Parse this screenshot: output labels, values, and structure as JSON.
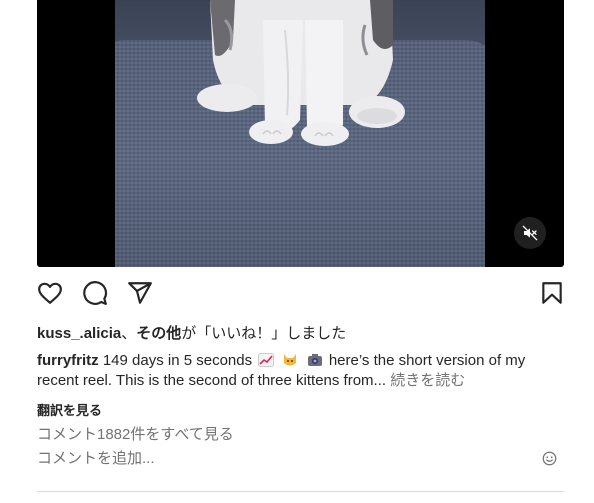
{
  "media": {
    "mute_icon": "speaker-muted-icon"
  },
  "actions": {
    "like_icon": "heart-icon",
    "comment_icon": "comment-icon",
    "share_icon": "send-icon",
    "save_icon": "bookmark-icon"
  },
  "likes": {
    "user": "kuss_.alicia",
    "separator": "、",
    "others": "その他",
    "suffix": "が「いいね！」しました"
  },
  "caption": {
    "username": "furryfritz",
    "text_start": "149 days in 5 seconds",
    "emojis": [
      "chart-increasing-emoji",
      "cat-face-emoji",
      "camera-emoji"
    ],
    "text_end": "here’s the short version of my recent reel. This is the second of three kittens from...",
    "more_label": "続きを読む"
  },
  "translate_label": "翻訳を見る",
  "view_comments_label": "コメント1882件をすべて見る",
  "comment_placeholder": "コメントを追加...",
  "colors": {
    "text": "#262626",
    "secondary": "#737373",
    "divider": "#dbdbdb"
  }
}
